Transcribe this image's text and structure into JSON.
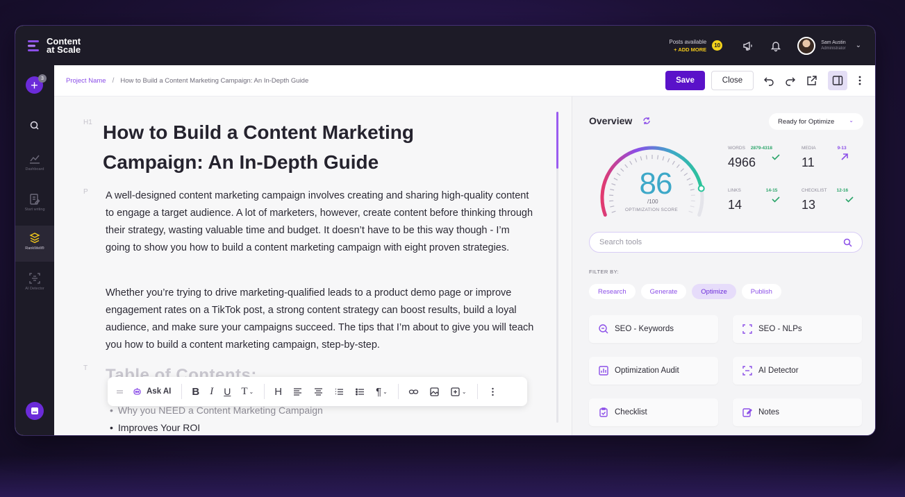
{
  "brand": {
    "name_line1": "Content",
    "name_line2": "at Scale"
  },
  "topbar": {
    "posts_label": "Posts available",
    "posts_add": "+ ADD MORE",
    "posts_count": "10",
    "user_name": "Sam Austin",
    "user_role": "Administrator"
  },
  "sidebar": {
    "new_badge": "3",
    "items": [
      {
        "label": "",
        "icon": "search-icon"
      },
      {
        "label": "Dashboard",
        "icon": "chart-icon"
      },
      {
        "label": "Start writing",
        "icon": "edit-icon"
      },
      {
        "label": "RankWell®",
        "icon": "stack-icon"
      },
      {
        "label": "AI Detector",
        "icon": "detector-icon"
      }
    ]
  },
  "breadcrumb": {
    "project": "Project Name",
    "separator": "/",
    "page": "How to Build a Content Marketing Campaign: An In-Depth Guide"
  },
  "actions": {
    "save": "Save",
    "close": "Close"
  },
  "editor": {
    "tag_h1": "H1",
    "tag_p": "P",
    "tag_t": "T",
    "title": "How to Build a Content Marketing Campaign: An In-Depth Guide",
    "paragraph1": "A well-designed content marketing campaign involves creating and sharing high-quality content to engage a target audience. A lot of marketers, however, create content before thinking through their strategy, wasting valuable time and budget. It doesn’t have to be this way though - I’m going to show you how to build a content marketing campaign with eight proven strategies.",
    "paragraph2": "Whether you’re trying to drive marketing-qualified leads to a product demo page or improve engagement rates on a TikTok post, a strong content strategy can boost results, build a loyal audience, and make sure your campaigns succeed. The tips that I’m about to give you will teach you how to build a content marketing campaign, step-by-step.",
    "toc_heading": "Table of Contents:",
    "toc_items": [
      "Why you NEED a Content Marketing Campaign",
      "Improves Your ROI"
    ]
  },
  "format_bar": {
    "ask_ai": "Ask AI"
  },
  "overview": {
    "title": "Overview",
    "status_select": "Ready for Optimize",
    "score": "86",
    "score_of": "/100",
    "score_label": "OPTIMIZATION SCORE",
    "score_value": 86,
    "metrics": {
      "words": {
        "label": "WORDS",
        "range": "2879-4318",
        "value": "4966"
      },
      "media": {
        "label": "MEDIA",
        "range": "9-13",
        "value": "11"
      },
      "links": {
        "label": "LINKS",
        "range": "14-15",
        "value": "14"
      },
      "checklist": {
        "label": "CHECKLIST",
        "range": "12-16",
        "value": "13"
      }
    },
    "search_placeholder": "Search tools",
    "filter_label": "FILTER BY:",
    "filters": [
      "Research",
      "Generate",
      "Optimize",
      "Publish"
    ],
    "tools": [
      "SEO - Keywords",
      "SEO - NLPs",
      "Optimization Audit",
      "AI Detector",
      "Checklist",
      "Notes"
    ]
  },
  "colors": {
    "accent": "#5a12c9",
    "brand_purple": "#8b4ee8",
    "dark": "#1d1b27",
    "success": "#2ba56a",
    "score": "#3da8c8"
  }
}
